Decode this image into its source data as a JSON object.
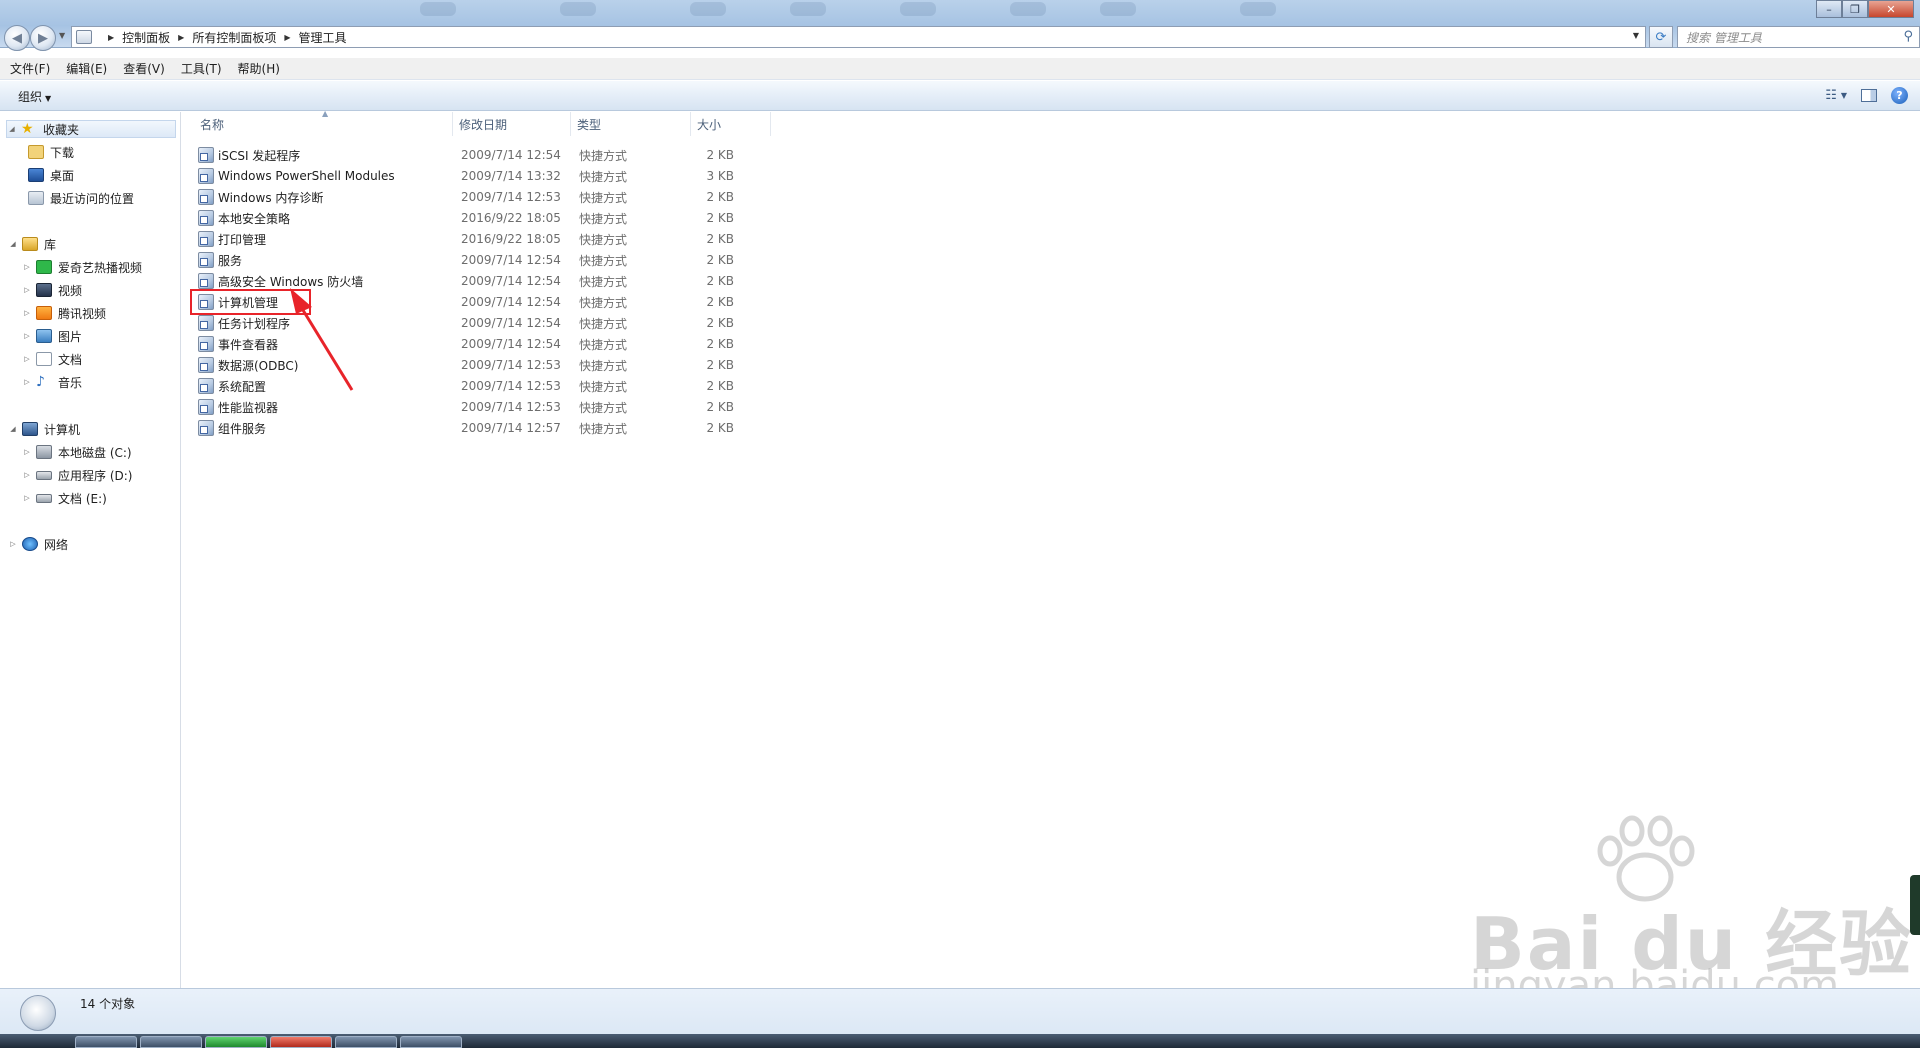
{
  "address": {
    "crumbs": [
      "控制面板",
      "所有控制面板项",
      "管理工具"
    ]
  },
  "search": {
    "placeholder": "搜索 管理工具"
  },
  "menu": [
    "文件(F)",
    "编辑(E)",
    "查看(V)",
    "工具(T)",
    "帮助(H)"
  ],
  "toolbar": {
    "organize": "组织"
  },
  "sidebar": {
    "favorites": "收藏夹",
    "favorites_items": [
      "下载",
      "桌面",
      "最近访问的位置"
    ],
    "libraries": "库",
    "libraries_items": [
      "爱奇艺热播视频",
      "视频",
      "腾讯视频",
      "图片",
      "文档",
      "音乐"
    ],
    "computer": "计算机",
    "computer_items": [
      "本地磁盘 (C:)",
      "应用程序 (D:)",
      "文档 (E:)"
    ],
    "network": "网络"
  },
  "columns": {
    "name": "名称",
    "date": "修改日期",
    "type": "类型",
    "size": "大小"
  },
  "files": [
    {
      "name": "iSCSI 发起程序",
      "date": "2009/7/14 12:54",
      "type": "快捷方式",
      "size": "2 KB"
    },
    {
      "name": "Windows PowerShell Modules",
      "date": "2009/7/14 13:32",
      "type": "快捷方式",
      "size": "3 KB"
    },
    {
      "name": "Windows 内存诊断",
      "date": "2009/7/14 12:53",
      "type": "快捷方式",
      "size": "2 KB"
    },
    {
      "name": "本地安全策略",
      "date": "2016/9/22 18:05",
      "type": "快捷方式",
      "size": "2 KB"
    },
    {
      "name": "打印管理",
      "date": "2016/9/22 18:05",
      "type": "快捷方式",
      "size": "2 KB"
    },
    {
      "name": "服务",
      "date": "2009/7/14 12:54",
      "type": "快捷方式",
      "size": "2 KB"
    },
    {
      "name": "高级安全 Windows 防火墙",
      "date": "2009/7/14 12:54",
      "type": "快捷方式",
      "size": "2 KB"
    },
    {
      "name": "计算机管理",
      "date": "2009/7/14 12:54",
      "type": "快捷方式",
      "size": "2 KB"
    },
    {
      "name": "任务计划程序",
      "date": "2009/7/14 12:54",
      "type": "快捷方式",
      "size": "2 KB"
    },
    {
      "name": "事件查看器",
      "date": "2009/7/14 12:54",
      "type": "快捷方式",
      "size": "2 KB"
    },
    {
      "name": "数据源(ODBC)",
      "date": "2009/7/14 12:53",
      "type": "快捷方式",
      "size": "2 KB"
    },
    {
      "name": "系统配置",
      "date": "2009/7/14 12:53",
      "type": "快捷方式",
      "size": "2 KB"
    },
    {
      "name": "性能监视器",
      "date": "2009/7/14 12:53",
      "type": "快捷方式",
      "size": "2 KB"
    },
    {
      "name": "组件服务",
      "date": "2009/7/14 12:57",
      "type": "快捷方式",
      "size": "2 KB"
    }
  ],
  "status": {
    "count": "14 个对象"
  },
  "watermark": {
    "main": "Bai du 经验",
    "url": "jingyan.baidu.com"
  },
  "colors": {
    "highlight": "#e8242a",
    "toolbar_blue": "#dce8f5"
  }
}
